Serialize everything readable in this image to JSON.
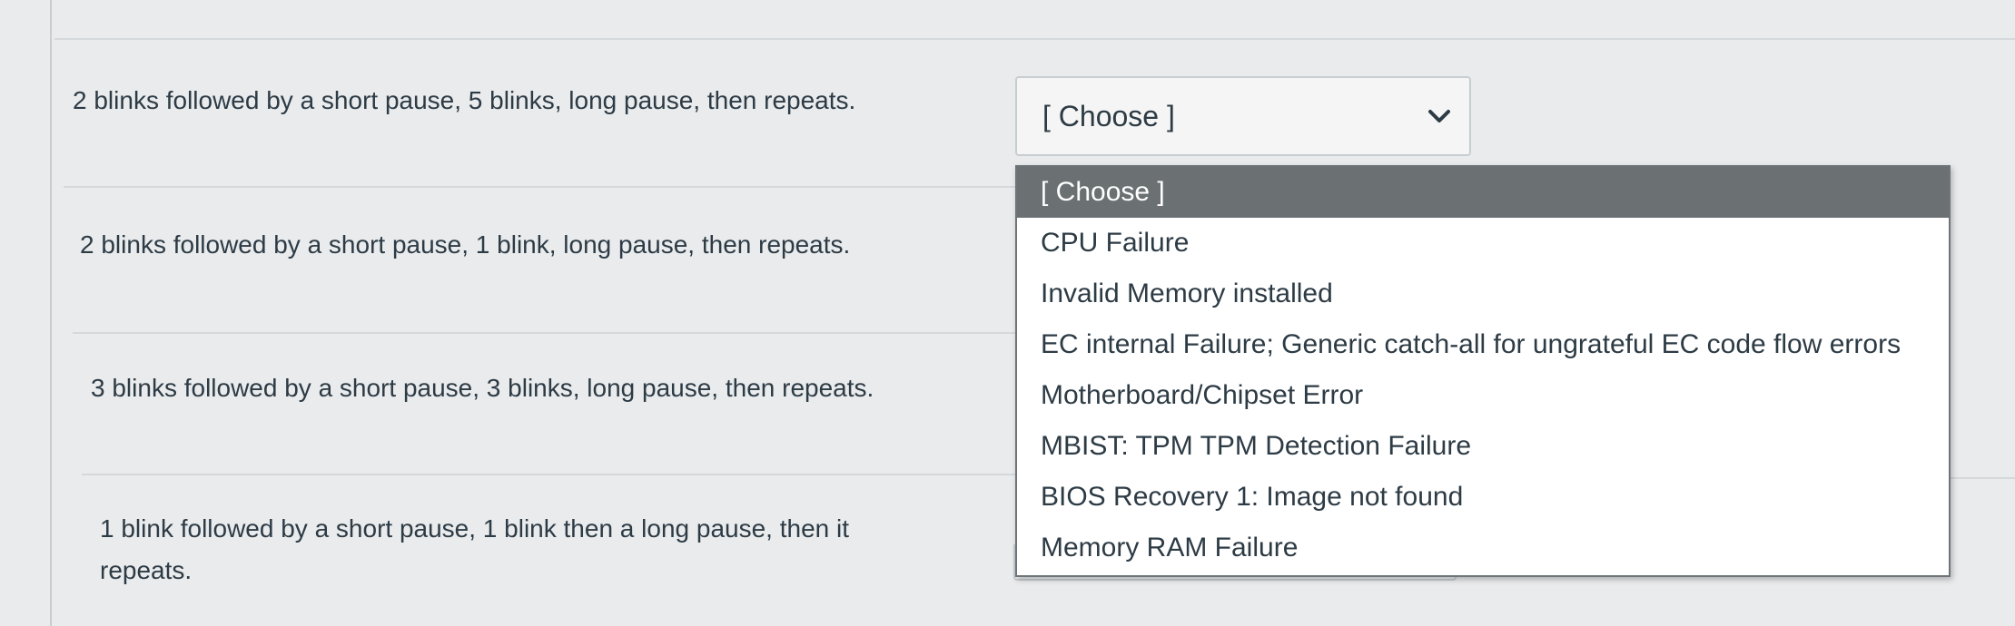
{
  "questions": [
    {
      "text": "2 blinks followed by a short pause, 5 blinks, long pause, then repeats."
    },
    {
      "text": "2 blinks followed by a short pause, 1 blink, long pause, then repeats."
    },
    {
      "text": "3 blinks followed by a short pause, 3 blinks, long pause, then repeats."
    },
    {
      "text_line1": "1 blink followed by a short pause, 1 blink then a long pause, then it",
      "text_line2": "repeats."
    }
  ],
  "select": {
    "value": "[ Choose ]",
    "options": [
      "[ Choose ]",
      "CPU Failure",
      "Invalid Memory installed",
      "EC internal Failure; Generic catch-all for ungrateful EC code flow errors",
      "Motherboard/Chipset Error",
      "MBIST: TPM TPM Detection Failure",
      "BIOS Recovery 1: Image not found",
      "Memory RAM Failure"
    ]
  },
  "icons": {
    "select_arrow": "chevron-down-icon"
  },
  "colors": {
    "background": "#e9ebed",
    "text": "#2d3b45",
    "selected_option_bg": "#6b7073",
    "selected_option_text": "#ffffff",
    "dropdown_bg": "#ffffff"
  }
}
